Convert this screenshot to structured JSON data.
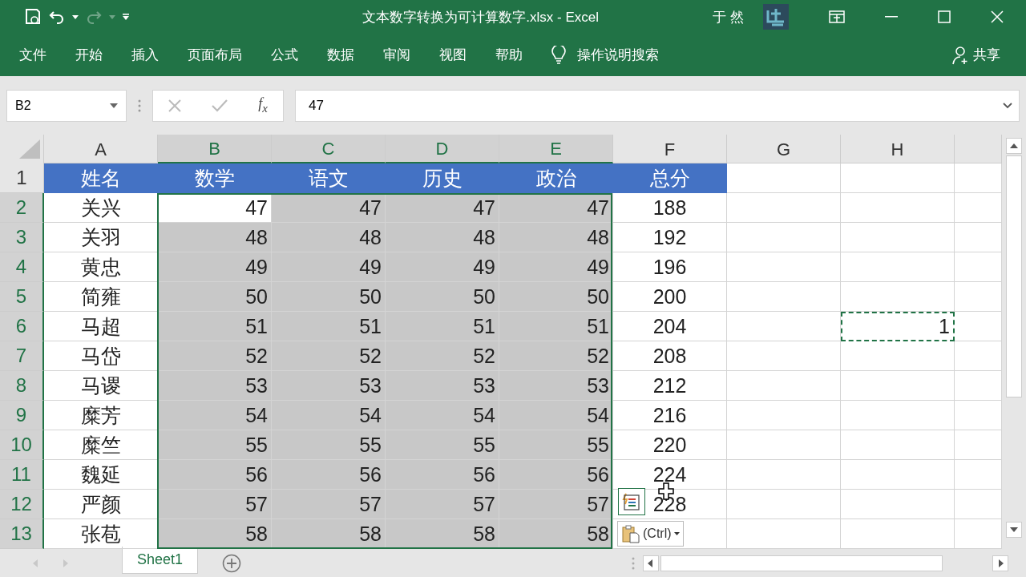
{
  "window": {
    "title": "文本数字转换为可计算数字.xlsx  -  Excel",
    "user": "于 然"
  },
  "quick_access": {
    "redo_disabled": true
  },
  "ribbon_tabs": [
    {
      "label": "文件"
    },
    {
      "label": "开始"
    },
    {
      "label": "插入"
    },
    {
      "label": "页面布局"
    },
    {
      "label": "公式"
    },
    {
      "label": "数据"
    },
    {
      "label": "审阅"
    },
    {
      "label": "视图"
    },
    {
      "label": "帮助"
    }
  ],
  "tell_me": "操作说明搜索",
  "share": "共享",
  "formula_bar": {
    "name_box": "B2",
    "fx": "f$_{x}$",
    "value": "47"
  },
  "columns": [
    {
      "letter": "A",
      "selected": false
    },
    {
      "letter": "B",
      "selected": true
    },
    {
      "letter": "C",
      "selected": true
    },
    {
      "letter": "D",
      "selected": true
    },
    {
      "letter": "E",
      "selected": true
    },
    {
      "letter": "F",
      "selected": false
    },
    {
      "letter": "G",
      "selected": false
    },
    {
      "letter": "H",
      "selected": false
    }
  ],
  "rows": [
    {
      "number": "1",
      "kind": "header",
      "selected": false,
      "cells": [
        "姓名",
        "数学",
        "语文",
        "历史",
        "政治",
        "总分"
      ]
    },
    {
      "number": "2",
      "kind": "data",
      "selected": true,
      "active": true,
      "cells": [
        "关兴",
        "47",
        "47",
        "47",
        "47",
        "188"
      ]
    },
    {
      "number": "3",
      "kind": "data",
      "selected": true,
      "active": false,
      "cells": [
        "关羽",
        "48",
        "48",
        "48",
        "48",
        "192"
      ]
    },
    {
      "number": "4",
      "kind": "data",
      "selected": true,
      "active": false,
      "cells": [
        "黄忠",
        "49",
        "49",
        "49",
        "49",
        "196"
      ]
    },
    {
      "number": "5",
      "kind": "data",
      "selected": true,
      "active": false,
      "cells": [
        "简雍",
        "50",
        "50",
        "50",
        "50",
        "200"
      ]
    },
    {
      "number": "6",
      "kind": "data",
      "selected": true,
      "active": false,
      "cells": [
        "马超",
        "51",
        "51",
        "51",
        "51",
        "204"
      ],
      "h_cell": {
        "value": "1",
        "copy_marquee": true
      }
    },
    {
      "number": "7",
      "kind": "data",
      "selected": true,
      "active": false,
      "cells": [
        "马岱",
        "52",
        "52",
        "52",
        "52",
        "208"
      ]
    },
    {
      "number": "8",
      "kind": "data",
      "selected": true,
      "active": false,
      "cells": [
        "马谡",
        "53",
        "53",
        "53",
        "53",
        "212"
      ]
    },
    {
      "number": "9",
      "kind": "data",
      "selected": true,
      "active": false,
      "cells": [
        "糜芳",
        "54",
        "54",
        "54",
        "54",
        "216"
      ]
    },
    {
      "number": "10",
      "kind": "data",
      "selected": true,
      "active": false,
      "cells": [
        "糜竺",
        "55",
        "55",
        "55",
        "55",
        "220"
      ]
    },
    {
      "number": "11",
      "kind": "data",
      "selected": true,
      "active": false,
      "cells": [
        "魏延",
        "56",
        "56",
        "56",
        "56",
        "224"
      ]
    },
    {
      "number": "12",
      "kind": "data",
      "selected": true,
      "active": false,
      "cells": [
        "严颜",
        "57",
        "57",
        "57",
        "57",
        "228"
      ]
    },
    {
      "number": "13",
      "kind": "data",
      "selected": true,
      "active": false,
      "cells": [
        "张苞",
        "58",
        "58",
        "58",
        "58"
      ]
    }
  ],
  "paste_options": {
    "label": "(Ctrl)"
  },
  "sheet_tabs": [
    {
      "label": "Sheet1",
      "selected": true
    }
  ]
}
